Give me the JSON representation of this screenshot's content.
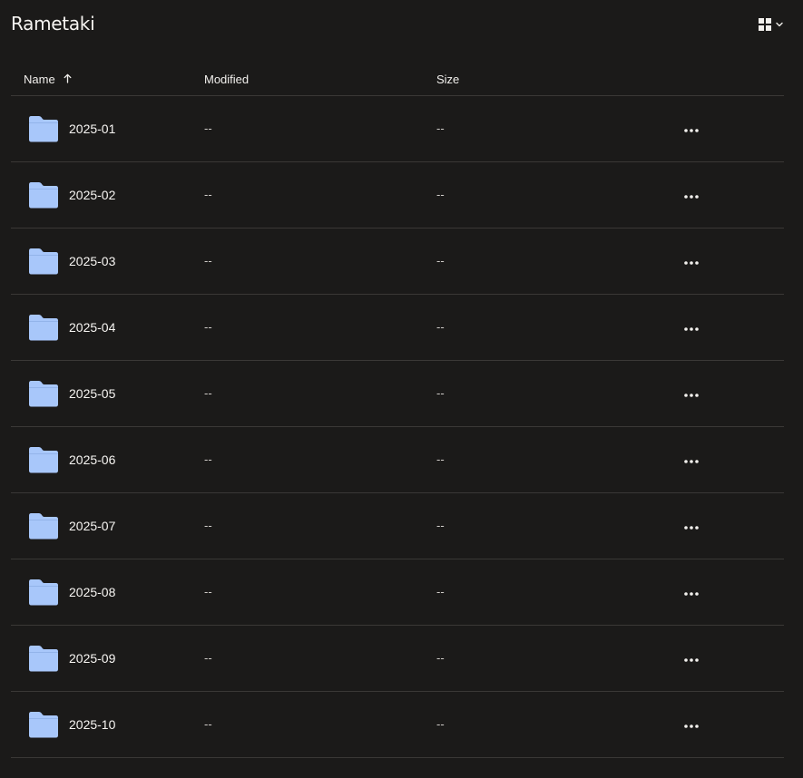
{
  "header": {
    "title": "Rametaki",
    "view_toggle_icon": "grid-icon",
    "view_toggle_chevron": "chevron-down-icon"
  },
  "table": {
    "columns": {
      "name": "Name",
      "modified": "Modified",
      "size": "Size"
    },
    "sort_icon": "arrow-up-icon",
    "rows": [
      {
        "name": "2025-01",
        "modified": "--",
        "size": "--"
      },
      {
        "name": "2025-02",
        "modified": "--",
        "size": "--"
      },
      {
        "name": "2025-03",
        "modified": "--",
        "size": "--"
      },
      {
        "name": "2025-04",
        "modified": "--",
        "size": "--"
      },
      {
        "name": "2025-05",
        "modified": "--",
        "size": "--"
      },
      {
        "name": "2025-06",
        "modified": "--",
        "size": "--"
      },
      {
        "name": "2025-07",
        "modified": "--",
        "size": "--"
      },
      {
        "name": "2025-08",
        "modified": "--",
        "size": "--"
      },
      {
        "name": "2025-09",
        "modified": "--",
        "size": "--"
      },
      {
        "name": "2025-10",
        "modified": "--",
        "size": "--"
      }
    ]
  },
  "colors": {
    "background": "#1b1a19",
    "folder": "#a8c7fa",
    "divider": "#3a3836",
    "text": "#f2f0ed"
  }
}
